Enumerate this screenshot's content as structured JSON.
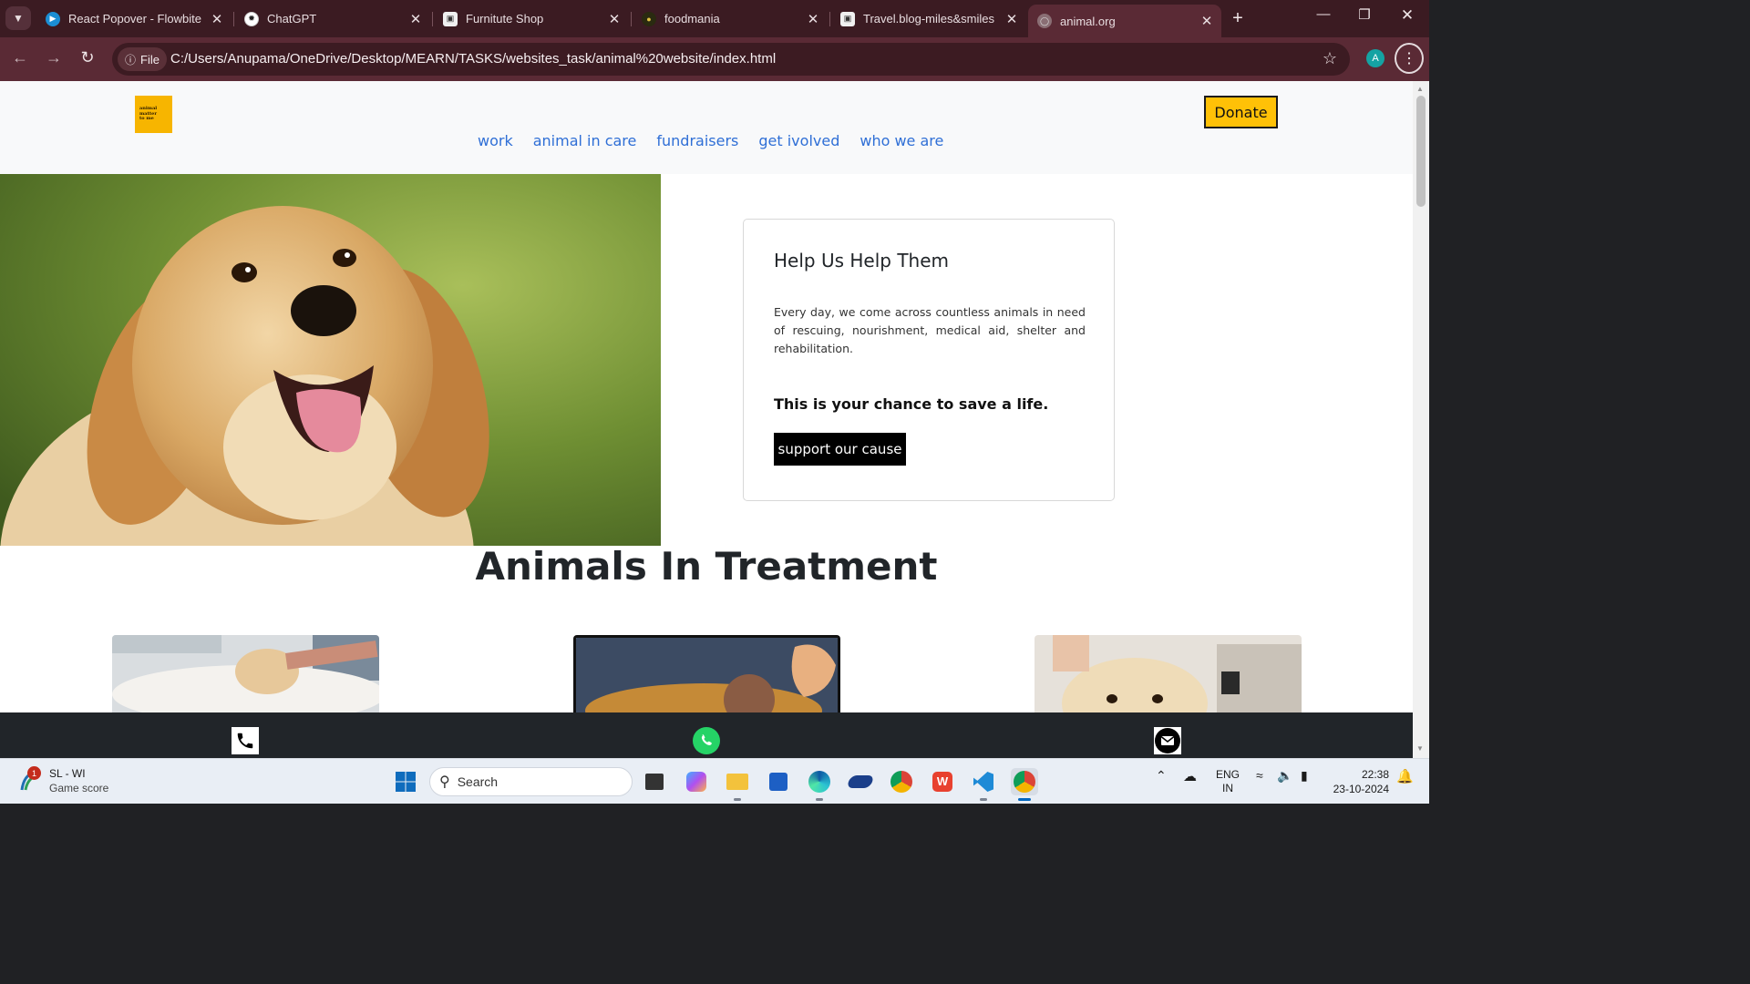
{
  "browser": {
    "tabs": [
      {
        "title": "React Popover - Flowbite",
        "icon": "flowbite-icon",
        "active": false
      },
      {
        "title": "ChatGPT",
        "icon": "chatgpt-icon",
        "active": false
      },
      {
        "title": "Furnitute Shop",
        "icon": "page-icon",
        "active": false
      },
      {
        "title": "foodmania",
        "icon": "foodmania-icon",
        "active": false
      },
      {
        "title": "Travel.blog-miles&smiles",
        "icon": "page-icon",
        "active": false
      },
      {
        "title": "animal.org",
        "icon": "globe-icon",
        "active": true
      }
    ],
    "file_chip": "File",
    "url": "C:/Users/Anupama/OneDrive/Desktop/MEARN/TASKS/websites_task/animal%20website/index.html",
    "profile_initial": "A"
  },
  "site": {
    "logo_lines": [
      "animal",
      "matter",
      "to me"
    ],
    "nav": [
      "work",
      "animal in care",
      "fundraisers",
      "get ivolved",
      "who we are"
    ],
    "donate_label": "Donate",
    "help_card": {
      "title": "Help Us Help Them",
      "text": "Every day, we come across countless animals in need of rescuing, nourishment, medical aid, shelter and rehabilitation.",
      "strong": "This is your chance to save a life.",
      "button": "support our cause"
    },
    "section_title": "Animals In Treatment",
    "contact_icons": [
      "phone-icon",
      "whatsapp-icon",
      "mail-icon"
    ],
    "colors": {
      "donate_bg": "#ffc107",
      "nav_link": "#2f6fd6",
      "footer_bg": "#212529"
    }
  },
  "taskbar": {
    "weather_title": "SL - WI",
    "weather_sub": "Game score",
    "weather_badge": "1",
    "search_placeholder": "Search",
    "lang_top": "ENG",
    "lang_bottom": "IN",
    "time": "22:38",
    "date": "23-10-2024"
  }
}
